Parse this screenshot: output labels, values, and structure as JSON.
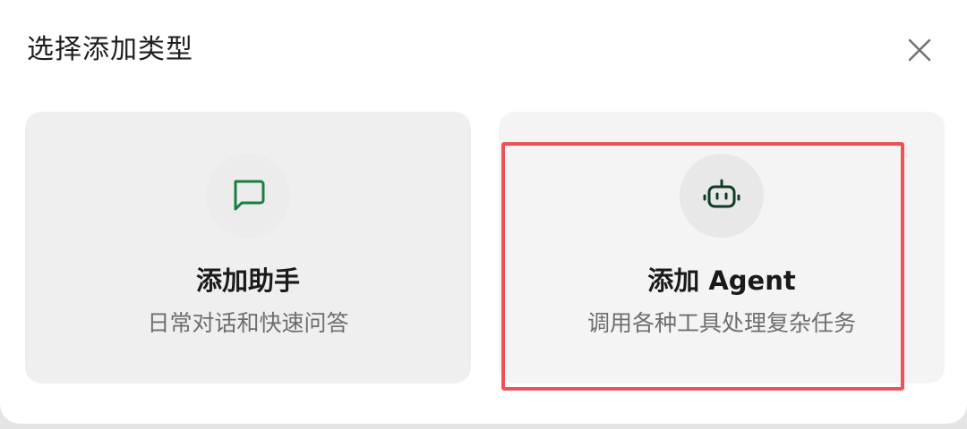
{
  "dialog": {
    "title": "选择添加类型",
    "close_icon": "close-icon"
  },
  "options": [
    {
      "title": "添加助手",
      "description": "日常对话和快速问答",
      "icon": "chat-bubble-icon",
      "icon_color": "#17803d"
    },
    {
      "title": "添加 Agent",
      "description": "调用各种工具处理复杂任务",
      "icon": "robot-icon",
      "icon_color": "#0f3d24",
      "highlighted": true
    }
  ],
  "colors": {
    "highlight": "#ee5258",
    "card_background": "#efefef"
  }
}
